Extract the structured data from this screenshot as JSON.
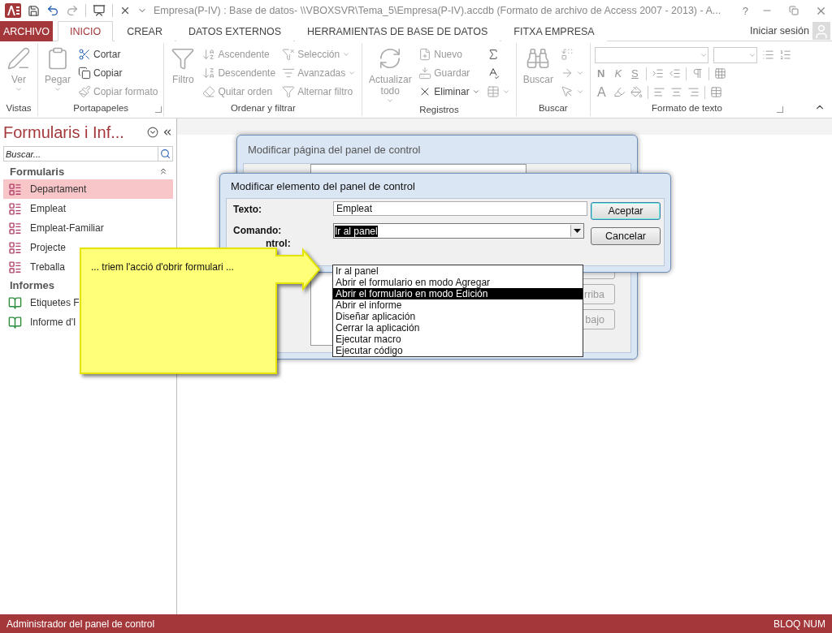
{
  "window": {
    "title": "Empresa(P-IV) : Base de datos- \\\\VBOXSVR\\Tema_5\\Empresa(P-IV).accdb (Formato de archivo de Access 2007 - 2013) - A...",
    "help": "?"
  },
  "tabs": [
    {
      "label": "ARCHIVO",
      "kind": "file",
      "selected": false
    },
    {
      "label": "INICIO",
      "kind": "tab",
      "selected": true
    },
    {
      "label": "CREAR",
      "kind": "tab",
      "selected": false
    },
    {
      "label": "DATOS EXTERNOS",
      "kind": "tab",
      "selected": false
    },
    {
      "label": "HERRAMIENTAS DE BASE DE DATOS",
      "kind": "tab",
      "selected": false
    },
    {
      "label": "FITXA EMPRESA",
      "kind": "tab",
      "selected": false
    }
  ],
  "sign_in": "Iniciar sesión",
  "ribbon": [
    {
      "label": "Vistas",
      "kind": "standard",
      "columns": [
        {
          "kind": "large",
          "label": "Ver",
          "disabled": true,
          "dropdown": true
        }
      ]
    },
    {
      "label": "Portapapeles",
      "kind": "standard",
      "launcher": true,
      "columns": [
        {
          "kind": "large",
          "label": "Pegar",
          "disabled": true,
          "dropdown": true
        },
        {
          "kind": "stack",
          "items": [
            {
              "label": "Cortar",
              "disabled": false,
              "dropdown": false
            },
            {
              "label": "Copiar",
              "disabled": false,
              "dropdown": false
            },
            {
              "label": "Copiar formato",
              "disabled": true,
              "dropdown": false
            }
          ]
        }
      ]
    },
    {
      "label": "Ordenar y filtrar",
      "kind": "standard",
      "columns": [
        {
          "kind": "large",
          "label": "Filtro",
          "disabled": true,
          "dropdown": false
        },
        {
          "kind": "stack",
          "items": [
            {
              "label": "Ascendente",
              "disabled": true,
              "dropdown": false
            },
            {
              "label": "Descendente",
              "disabled": true,
              "dropdown": false
            },
            {
              "label": "Quitar orden",
              "disabled": true,
              "dropdown": false
            }
          ]
        },
        {
          "kind": "stack",
          "items": [
            {
              "label": "Selección",
              "disabled": true,
              "dropdown": true
            },
            {
              "label": "Avanzadas",
              "disabled": true,
              "dropdown": true
            },
            {
              "label": "Alternar filtro",
              "disabled": true,
              "dropdown": false
            }
          ]
        }
      ]
    },
    {
      "label": "Registros",
      "kind": "standard",
      "columns": [
        {
          "kind": "large",
          "label": "Actualizar todo",
          "disabled": true,
          "dropdown": true
        },
        {
          "kind": "stack",
          "items": [
            {
              "label": "Nuevo",
              "disabled": true,
              "dropdown": false
            },
            {
              "label": "Guardar",
              "disabled": true,
              "dropdown": false
            },
            {
              "label": "Eliminar",
              "disabled": false,
              "dropdown": true
            }
          ]
        },
        {
          "kind": "stack",
          "items": [
            {
              "disabled": false,
              "dropdown": false
            },
            {
              "disabled": false,
              "dropdown": false
            },
            {
              "disabled": true,
              "dropdown": true
            }
          ]
        }
      ]
    },
    {
      "label": "Buscar",
      "kind": "standard",
      "columns": [
        {
          "kind": "large",
          "label": "Buscar",
          "disabled": true,
          "dropdown": false
        },
        {
          "kind": "stack",
          "items": [
            {
              "disabled": true,
              "dropdown": false
            },
            {
              "disabled": true,
              "dropdown": true
            },
            {
              "disabled": true,
              "dropdown": true
            }
          ]
        }
      ]
    },
    {
      "label": "Formato de texto",
      "kind": "format",
      "launcher": true,
      "letters": [
        "N",
        "K",
        "S"
      ],
      "color_letter": "A"
    }
  ],
  "nav_pane": {
    "title": "Formularis i Inf...",
    "search_placeholder": "Buscar...",
    "sections": [
      {
        "label": "Formularis",
        "kind": "form",
        "items": [
          {
            "label": "Departament",
            "selected": true
          },
          {
            "label": "Empleat",
            "selected": false
          },
          {
            "label": "Empleat-Familiar",
            "selected": false
          },
          {
            "label": "Projecte",
            "selected": false
          },
          {
            "label": "Treballa",
            "selected": false
          }
        ]
      },
      {
        "label": "Informes",
        "kind": "report",
        "items": [
          {
            "label": "Etiquetes F",
            "selected": false
          },
          {
            "label": "Informe d'I",
            "selected": false
          }
        ]
      }
    ]
  },
  "back_dialog": {
    "title": "Modificar página del panel de control",
    "buttons": [
      "rriba",
      "bajo"
    ]
  },
  "dialog": {
    "title": "Modificar elemento del panel de control",
    "text_label": "Texto:",
    "text_value": "Empleat",
    "command_label": "Comando:",
    "command_value": "Ir al panel",
    "panel_label": "ntrol:",
    "options": [
      {
        "label": "Ir al panel",
        "selected": false
      },
      {
        "label": "Abrir el formulario en modo Agregar",
        "selected": false
      },
      {
        "label": "Abrir el formulario en modo Edición",
        "selected": true
      },
      {
        "label": "Abrir el informe",
        "selected": false
      },
      {
        "label": "Diseñar aplicación",
        "selected": false
      },
      {
        "label": "Cerrar la aplicación",
        "selected": false
      },
      {
        "label": "Ejecutar macro",
        "selected": false
      },
      {
        "label": "Ejecutar código",
        "selected": false
      }
    ],
    "buttons": [
      "Aceptar",
      "Cancelar"
    ]
  },
  "callout": {
    "text": "... triem l'acció d'obrir formulari ..."
  },
  "status_bar": {
    "left": "Administrador del panel de control",
    "right": "BLOQ NUM"
  }
}
